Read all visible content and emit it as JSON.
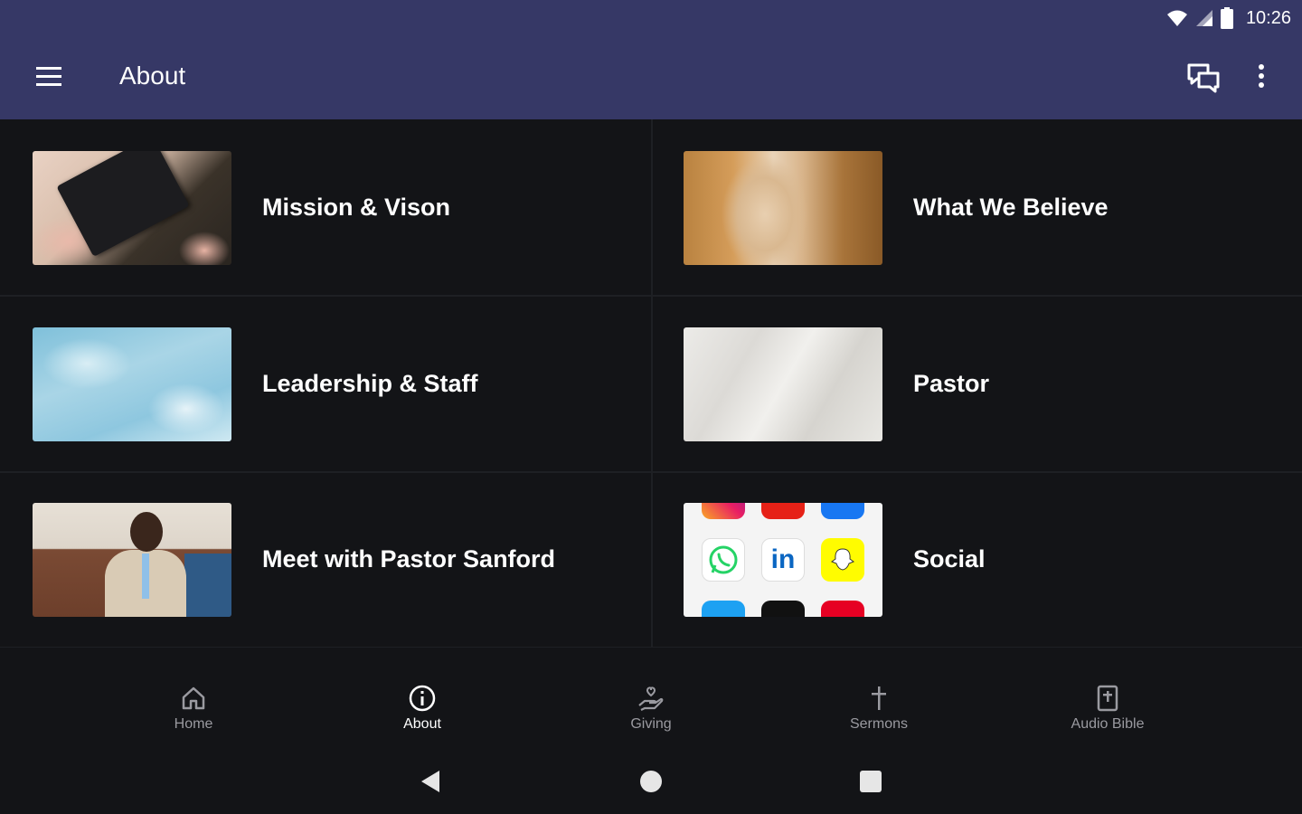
{
  "status_bar": {
    "time": "10:26",
    "icons": [
      "wifi-icon",
      "signal-icon",
      "battery-icon"
    ]
  },
  "app_bar": {
    "title": "About",
    "color": "#363866",
    "icons": [
      "menu-icon",
      "chat-icon",
      "more-vert-icon"
    ]
  },
  "tiles": [
    {
      "label": "Mission & Vison",
      "thumb": "bible-with-tulips"
    },
    {
      "label": "What We Believe",
      "thumb": "empty-tomb"
    },
    {
      "label": "Leadership & Staff",
      "thumb": "blue-sky"
    },
    {
      "label": "Pastor",
      "thumb": "white-fabric"
    },
    {
      "label": "Meet with Pastor Sanford",
      "thumb": "pastor-portrait"
    },
    {
      "label": "Social",
      "thumb": "social-app-icons"
    }
  ],
  "social_thumb": {
    "linkedin_text": "in"
  },
  "bottom_nav": {
    "items": [
      {
        "label": "Home",
        "icon": "home-icon",
        "active": false
      },
      {
        "label": "About",
        "icon": "info-icon",
        "active": true
      },
      {
        "label": "Giving",
        "icon": "giving-hand-icon",
        "active": false
      },
      {
        "label": "Sermons",
        "icon": "cross-icon",
        "active": false
      },
      {
        "label": "Audio Bible",
        "icon": "bible-icon",
        "active": false
      }
    ]
  },
  "system_nav": [
    "back-icon",
    "home-circle-icon",
    "recents-icon"
  ],
  "colors": {
    "background": "#131417",
    "divider": "#1e2024",
    "nav_inactive": "#9a9aa0",
    "nav_active": "#ffffff"
  }
}
